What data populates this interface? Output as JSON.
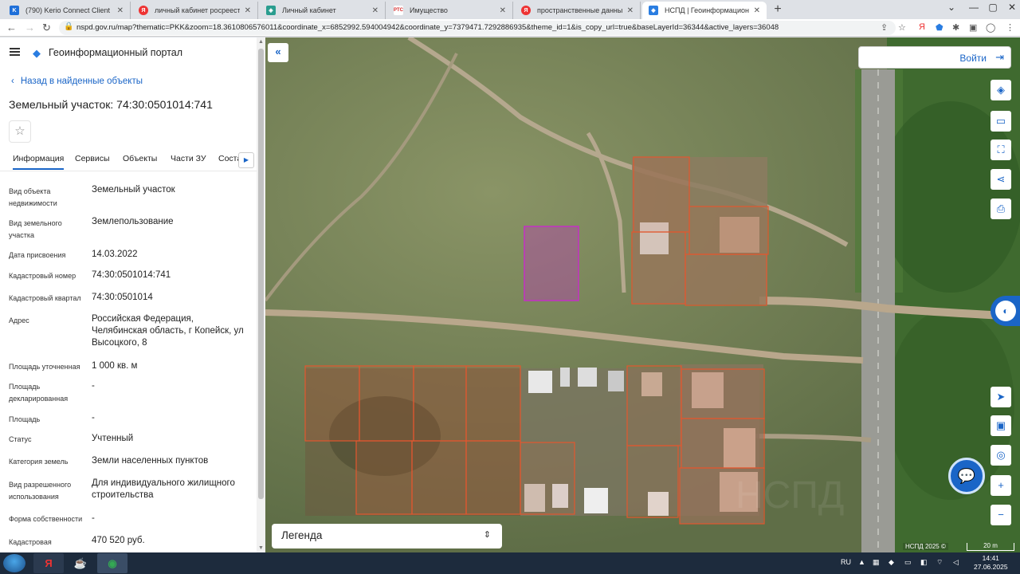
{
  "browser": {
    "tabs": [
      {
        "title": "(790) Kerio Connect Client",
        "icon": "kerio-icon",
        "color": "#1e6fd9"
      },
      {
        "title": "личный кабинет росреестра —",
        "icon": "yandex-icon",
        "color": "#e33"
      },
      {
        "title": "Личный кабинет",
        "icon": "rosreestr-icon",
        "color": "#2a9d8f"
      },
      {
        "title": "Имущество",
        "icon": "rts-icon",
        "color": "#d62828"
      },
      {
        "title": "пространственные данные рос",
        "icon": "yandex-icon",
        "color": "#e33"
      },
      {
        "title": "НСПД | Геоинформационный п",
        "icon": "nspd-icon",
        "color": "#2a7de1"
      }
    ],
    "url": "nspd.gov.ru/map?thematic=PKK&zoom=18.3610806576011&coordinate_x=6852992.594004942&coordinate_y=7379471.7292886935&theme_id=1&is_copy_url=true&baseLayerId=36344&active_layers=36048"
  },
  "panel": {
    "portal_title": "Геоинформационный портал",
    "back_link": "Назад в найденные объекты",
    "object_title": "Земельный участок: 74:30:0501014:741",
    "tabs": [
      "Информация",
      "Сервисы",
      "Объекты",
      "Части ЗУ",
      "Соста"
    ],
    "attributes": [
      {
        "label": "Вид объекта недвижимости",
        "value": "Земельный участок"
      },
      {
        "label": "Вид земельного участка",
        "value": "Землепользование"
      },
      {
        "label": "Дата присвоения",
        "value": "14.03.2022"
      },
      {
        "label": "Кадастровый номер",
        "value": "74:30:0501014:741"
      },
      {
        "label": "Кадастровый квартал",
        "value": "74:30:0501014"
      },
      {
        "label": "Адрес",
        "value": "Российская Федерация, Челябинская область, г Копейск, ул Высоцкого, 8"
      },
      {
        "label": "Площадь уточненная",
        "value": "1 000 кв. м"
      },
      {
        "label": "Площадь декларированная",
        "value": "-"
      },
      {
        "label": "Площадь",
        "value": "-"
      },
      {
        "label": "Статус",
        "value": "Учтенный"
      },
      {
        "label": "Категория земель",
        "value": "Земли населенных пунктов"
      },
      {
        "label": "Вид разрешенного использования",
        "value": "Для индивидуального жилищного строительства"
      },
      {
        "label": "Форма собственности",
        "value": "-"
      },
      {
        "label": "Кадастровая",
        "value": "470 520 руб."
      }
    ]
  },
  "map": {
    "login_label": "Войти",
    "legend_label": "Легенда",
    "attribution": "НСПД 2025 ©",
    "scale_label": "20 m",
    "colors": {
      "parcel": "#e2572f",
      "selected": "#c430c4",
      "accent": "#1a65c7"
    }
  },
  "taskbar": {
    "lang": "RU",
    "time": "14:41",
    "date": "27.06.2025"
  }
}
